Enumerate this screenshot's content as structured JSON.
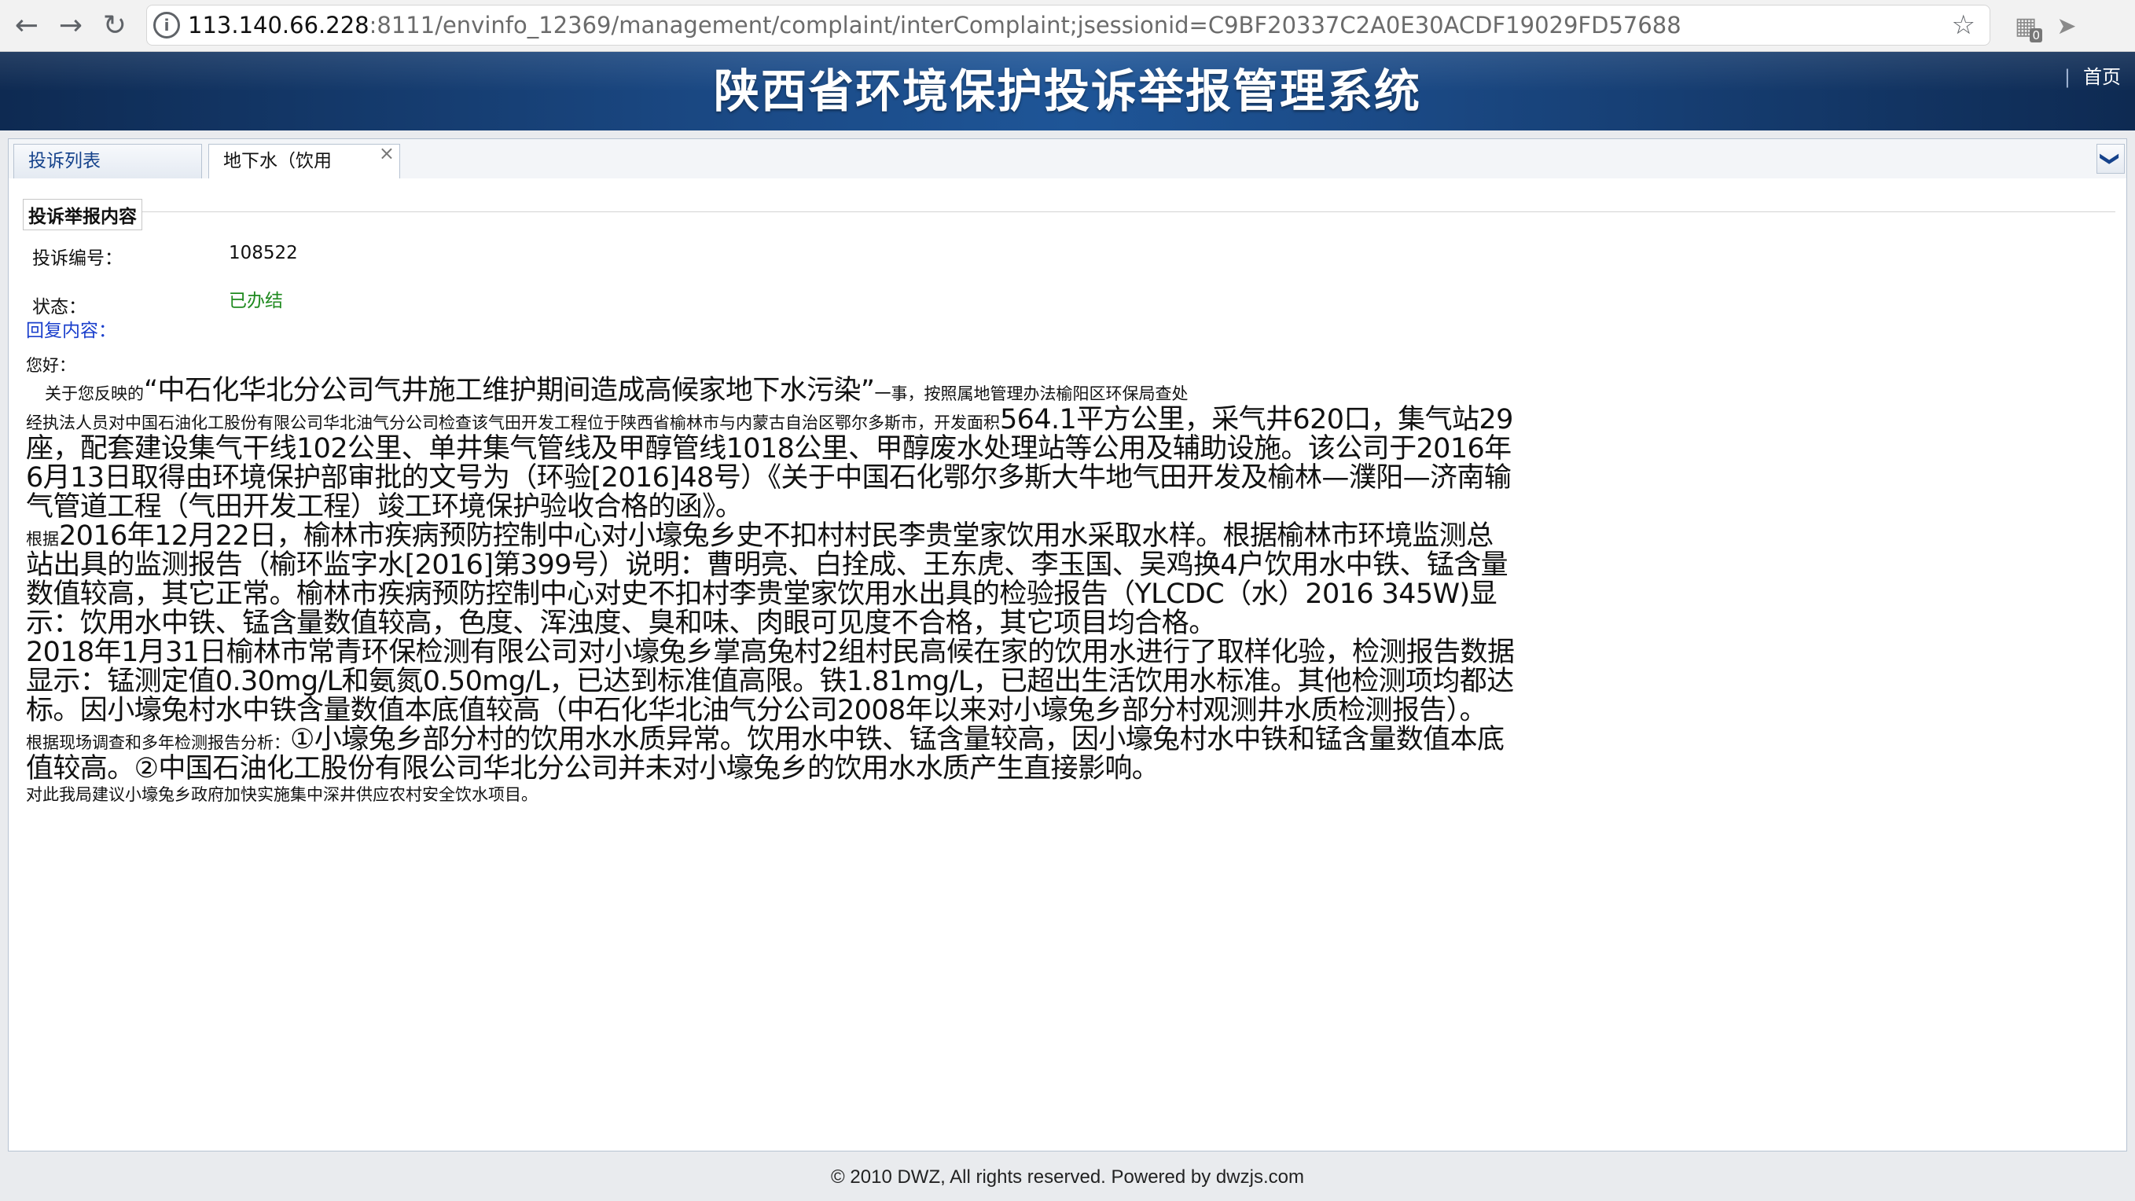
{
  "browser": {
    "url_host": "113.140.66.228",
    "url_rest": ":8111/envinfo_12369/management/complaint/interComplaint;jsessionid=C9BF20337C2A0E30ACDF19029FD57688",
    "ext_badge": "0"
  },
  "header": {
    "title": "陕西省环境保护投诉举报管理系统",
    "home_label": "首页",
    "home_sep": "|"
  },
  "tabs": {
    "items": [
      {
        "label": "投诉列表"
      },
      {
        "label": "地下水（饮用"
      }
    ],
    "close_glyph": "×",
    "more_glyph": "❯"
  },
  "content": {
    "section_title": "投诉举报内容",
    "id_label": "投诉编号：",
    "id_value": "108522",
    "status_label": "状态：",
    "status_value": "已办结",
    "reply_label": "回复内容："
  },
  "reply": {
    "greeting": "您好：",
    "p1_small": "关于您反映的",
    "p1_large": "“中石化华北分公司气井施工维护期间造成高候家地下水污染”",
    "p1_tail": "一事，按照属地管理办法榆阳区环保局查处",
    "p2_small": "经执法人员对中国石油化工股份有限公司华北油气分公司检查该气田开发工程位于陕西省榆林市与内蒙古自治区鄂尔多斯市，开发面积",
    "p2_large": "564.1平方公里，采气井620口，集气站29座，配套建设集气干线102公里、单井集气管线及甲醇管线1018公里、甲醇废水处理站等公用及辅助设施。该公司于2016年6月13日取得由环境保护部审批的文号为（环验[2016]48号）《关于中国石化鄂尔多斯大牛地气田开发及榆林—濮阳—济南输气管道工程（气田开发工程）竣工环境保护验收合格的函》。",
    "p3_small": "根据",
    "p3_large": "2016年12月22日，榆林市疾病预防控制中心对小壕兔乡史不扣村村民李贵堂家饮用水采取水样。根据榆林市环境监测总站出具的监测报告（榆环监字水[2016]第399号）说明：曹明亮、白拴成、王东虎、李玉国、吴鸡换4户饮用水中铁、锰含量数值较高，其它正常。榆林市疾病预防控制中心对史不扣村李贵堂家饮用水出具的检验报告（YLCDC（水）2016 345W)显示：饮用水中铁、锰含量数值较高，色度、浑浊度、臭和味、肉眼可见度不合格，其它项目均合格。",
    "p4_large": "2018年1月31日榆林市常青环保检测有限公司对小壕兔乡掌高兔村2组村民高候在家的饮用水进行了取样化验，检测报告数据显示：锰测定值0.30mg/L和氨氮0.50mg/L，已达到标准值高限。铁1.81mg/L，已超出生活饮用水标准。其他检测项均都达标。因小壕兔村水中铁含量数值本底值较高（中石化华北油气分公司2008年以来对小壕兔乡部分村观测井水质检测报告）。",
    "p5_small": "根据现场调查和多年检测报告分析：",
    "p5_large": "①小壕兔乡部分村的饮用水水质异常。饮用水中铁、锰含量较高，因小壕兔村水中铁和锰含量数值本底值较高。②中国石油化工股份有限公司华北分公司并未对小壕兔乡的饮用水水质产生直接影响。",
    "p6_small": "对此我局建议小壕兔乡政府加快实施集中深井供应农村安全饮水项目。"
  },
  "footer": {
    "text": "© 2010 DWZ, All rights reserved. Powered by dwzjs.com"
  }
}
